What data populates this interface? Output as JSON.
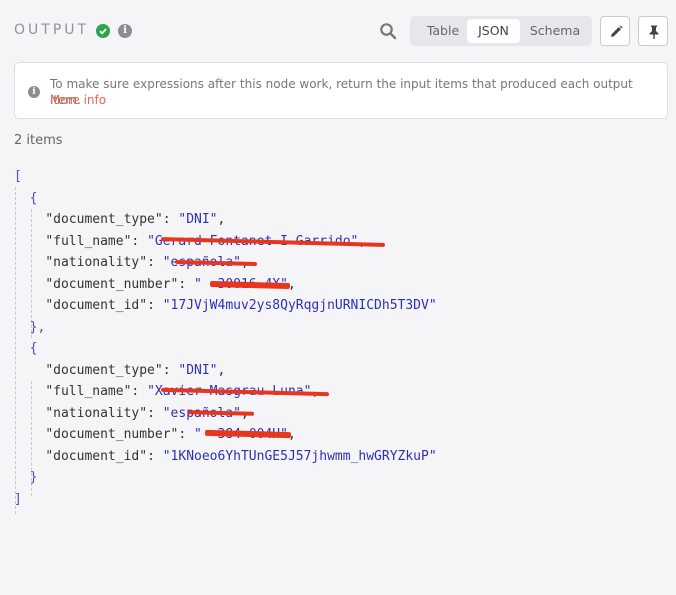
{
  "header": {
    "title": "OUTPUT",
    "view_tabs": [
      {
        "label": "Table",
        "active": false
      },
      {
        "label": "JSON",
        "active": true
      },
      {
        "label": "Schema",
        "active": false
      }
    ]
  },
  "notice": {
    "text": "To make sure expressions after this node work, return the input items that produced each output item.",
    "link": "More info"
  },
  "items_count": "2 items",
  "json": {
    "open_array": "[",
    "close_array": "]",
    "items": [
      {
        "document_type": "\"DNI\"",
        "full_name": "\"Gerard Fontanet I Garrido\"",
        "nationality": "\"española\"",
        "document_number": "\"  30016 4X\"",
        "document_id": "\"17JVjW4muv2ys8QyRqgjnURNICDh5T3DV\""
      },
      {
        "document_type": "\"DNI\"",
        "full_name": "\"Xavier Masgrau Luna\"",
        "nationality": "\"española\"",
        "document_number": "\"  384 004H\"",
        "document_id": "\"1KNoeo6YhTUnGE5J57jhwmm_hwGRYZkuP\""
      }
    ]
  },
  "colors": {
    "accent": "#e8684a",
    "success": "#2ea44f",
    "string": "#2f2fb3",
    "redaction": "#e8361c"
  },
  "icons": [
    "check-circle-icon",
    "info-icon",
    "search-icon",
    "pencil-icon",
    "pin-icon"
  ]
}
